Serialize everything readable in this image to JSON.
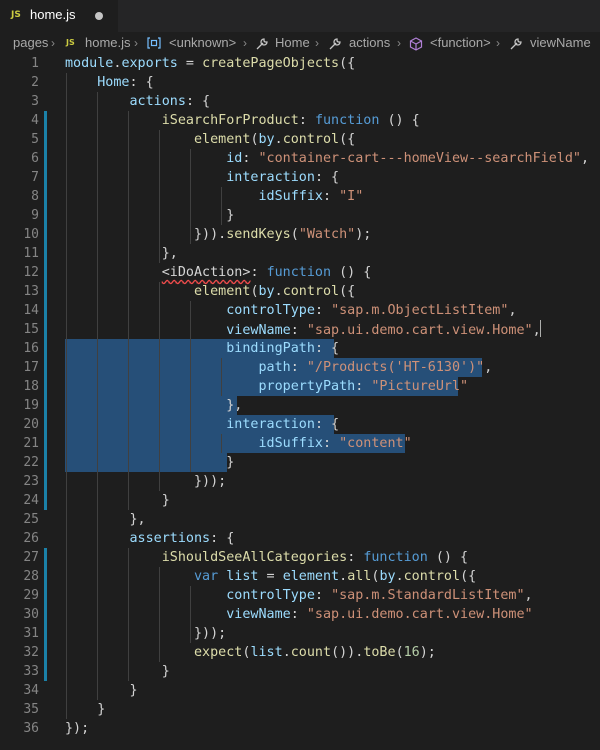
{
  "tab": {
    "badge": "JS",
    "title": "home.js"
  },
  "breadcrumb": {
    "items": [
      "pages",
      "JS",
      "home.js",
      "<unknown>",
      "Home",
      "actions",
      "<function>",
      "viewName"
    ]
  },
  "lines": [
    [
      [
        "v",
        "module"
      ],
      [
        "p",
        "."
      ],
      [
        "v",
        "exports"
      ],
      [
        "p",
        " = "
      ],
      [
        "f",
        "createPageObjects"
      ],
      [
        "p",
        "({"
      ]
    ],
    [
      [
        "p",
        "    "
      ],
      [
        "v",
        "Home"
      ],
      [
        "p",
        ": {"
      ]
    ],
    [
      [
        "p",
        "        "
      ],
      [
        "v",
        "actions"
      ],
      [
        "p",
        ": {"
      ]
    ],
    [
      [
        "p",
        "            "
      ],
      [
        "f",
        "iSearchForProduct"
      ],
      [
        "p",
        ": "
      ],
      [
        "k",
        "function"
      ],
      [
        "p",
        " () {"
      ]
    ],
    [
      [
        "p",
        "                "
      ],
      [
        "f",
        "element"
      ],
      [
        "p",
        "("
      ],
      [
        "v",
        "by"
      ],
      [
        "p",
        "."
      ],
      [
        "f",
        "control"
      ],
      [
        "p",
        "({"
      ]
    ],
    [
      [
        "p",
        "                    "
      ],
      [
        "v",
        "id"
      ],
      [
        "p",
        ": "
      ],
      [
        "s",
        "\"container-cart---homeView--searchField\""
      ],
      [
        "p",
        ","
      ]
    ],
    [
      [
        "p",
        "                    "
      ],
      [
        "v",
        "interaction"
      ],
      [
        "p",
        ": {"
      ]
    ],
    [
      [
        "p",
        "                        "
      ],
      [
        "v",
        "idSuffix"
      ],
      [
        "p",
        ": "
      ],
      [
        "s",
        "\"I\""
      ]
    ],
    [
      [
        "p",
        "                    }"
      ]
    ],
    [
      [
        "p",
        "                }))."
      ],
      [
        "f",
        "sendKeys"
      ],
      [
        "p",
        "("
      ],
      [
        "s",
        "\"Watch\""
      ],
      [
        "p",
        ");"
      ]
    ],
    [
      [
        "p",
        "            },"
      ]
    ],
    [
      [
        "p",
        "            "
      ],
      [
        "sq",
        "<iDoAction>"
      ],
      [
        "p",
        ": "
      ],
      [
        "k",
        "function"
      ],
      [
        "p",
        " () {"
      ]
    ],
    [
      [
        "p",
        "                "
      ],
      [
        "f",
        "element"
      ],
      [
        "p",
        "("
      ],
      [
        "v",
        "by"
      ],
      [
        "p",
        "."
      ],
      [
        "f",
        "control"
      ],
      [
        "p",
        "({"
      ]
    ],
    [
      [
        "p",
        "                    "
      ],
      [
        "v",
        "controlType"
      ],
      [
        "p",
        ": "
      ],
      [
        "s",
        "\"sap.m.ObjectListItem\""
      ],
      [
        "p",
        ","
      ]
    ],
    [
      [
        "p",
        "                    "
      ],
      [
        "v",
        "viewName"
      ],
      [
        "p",
        ": "
      ],
      [
        "s",
        "\"sap.ui.demo.cart.view.Home\""
      ],
      [
        "p",
        ","
      ]
    ],
    [
      [
        "p",
        "                    "
      ],
      [
        "v",
        "bindingPath"
      ],
      [
        "p",
        ": {"
      ]
    ],
    [
      [
        "p",
        "                        "
      ],
      [
        "v",
        "path"
      ],
      [
        "p",
        ": "
      ],
      [
        "s",
        "\"/Products('HT-6130')\""
      ],
      [
        "p",
        ","
      ]
    ],
    [
      [
        "p",
        "                        "
      ],
      [
        "v",
        "propertyPath"
      ],
      [
        "p",
        ": "
      ],
      [
        "s",
        "\"PictureUrl\""
      ]
    ],
    [
      [
        "p",
        "                    },"
      ]
    ],
    [
      [
        "p",
        "                    "
      ],
      [
        "v",
        "interaction"
      ],
      [
        "p",
        ": {"
      ]
    ],
    [
      [
        "p",
        "                        "
      ],
      [
        "v",
        "idSuffix"
      ],
      [
        "p",
        ": "
      ],
      [
        "s",
        "\"content\""
      ]
    ],
    [
      [
        "p",
        "                    }"
      ]
    ],
    [
      [
        "p",
        "                }));"
      ]
    ],
    [
      [
        "p",
        "            }"
      ]
    ],
    [
      [
        "p",
        "        },"
      ]
    ],
    [
      [
        "p",
        "        "
      ],
      [
        "v",
        "assertions"
      ],
      [
        "p",
        ": {"
      ]
    ],
    [
      [
        "p",
        "            "
      ],
      [
        "f",
        "iShouldSeeAllCategories"
      ],
      [
        "p",
        ": "
      ],
      [
        "k",
        "function"
      ],
      [
        "p",
        " () {"
      ]
    ],
    [
      [
        "p",
        "                "
      ],
      [
        "k",
        "var"
      ],
      [
        "p",
        " "
      ],
      [
        "v",
        "list"
      ],
      [
        "p",
        " = "
      ],
      [
        "v",
        "element"
      ],
      [
        "p",
        "."
      ],
      [
        "f",
        "all"
      ],
      [
        "p",
        "("
      ],
      [
        "v",
        "by"
      ],
      [
        "p",
        "."
      ],
      [
        "f",
        "control"
      ],
      [
        "p",
        "({"
      ]
    ],
    [
      [
        "p",
        "                    "
      ],
      [
        "v",
        "controlType"
      ],
      [
        "p",
        ": "
      ],
      [
        "s",
        "\"sap.m.StandardListItem\""
      ],
      [
        "p",
        ","
      ]
    ],
    [
      [
        "p",
        "                    "
      ],
      [
        "v",
        "viewName"
      ],
      [
        "p",
        ": "
      ],
      [
        "s",
        "\"sap.ui.demo.cart.view.Home\""
      ]
    ],
    [
      [
        "p",
        "                }));"
      ]
    ],
    [
      [
        "p",
        "                "
      ],
      [
        "f",
        "expect"
      ],
      [
        "p",
        "("
      ],
      [
        "v",
        "list"
      ],
      [
        "p",
        "."
      ],
      [
        "f",
        "count"
      ],
      [
        "p",
        "())."
      ],
      [
        "f",
        "toBe"
      ],
      [
        "p",
        "("
      ],
      [
        "n",
        "16"
      ],
      [
        "p",
        ");"
      ]
    ],
    [
      [
        "p",
        "            }"
      ]
    ],
    [
      [
        "p",
        "        }"
      ]
    ],
    [
      [
        "p",
        "    }"
      ]
    ],
    [
      [
        "p",
        "});"
      ]
    ]
  ]
}
